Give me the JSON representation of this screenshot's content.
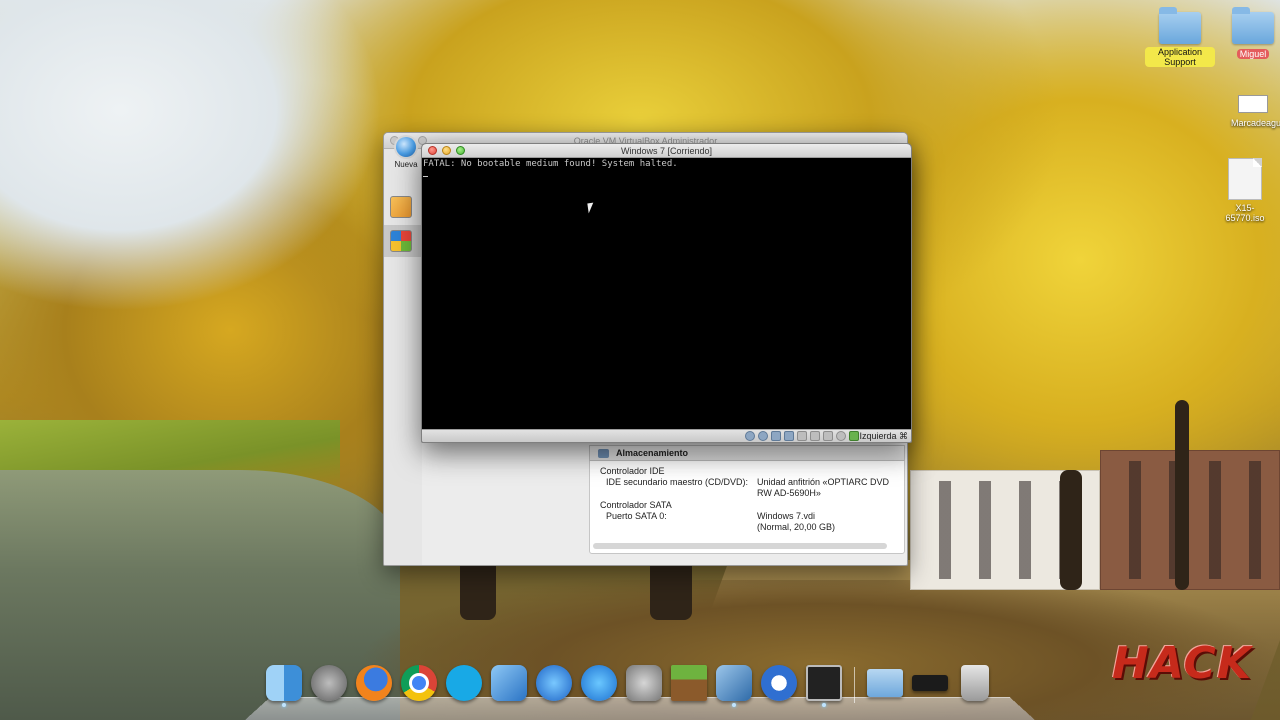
{
  "desktop": {
    "icons": [
      {
        "label": "Application Support",
        "kind": "folder"
      },
      {
        "label": "Miguel",
        "kind": "folder"
      },
      {
        "label": "Marcadeagua.png",
        "kind": "image"
      },
      {
        "label": "X15-65770.iso",
        "kind": "disk-image"
      }
    ]
  },
  "manager": {
    "title": "Oracle VM VirtualBox Administrador",
    "toolbar_new": "Nueva",
    "storage_header": "Almacenamiento",
    "storage": {
      "ide_controller": "Controlador IDE",
      "ide_port": "IDE secundario maestro (CD/DVD):",
      "ide_value_1": "Unidad anfitrión «OPTIARC DVD",
      "ide_value_2": "RW AD-5690H»",
      "sata_controller": "Controlador SATA",
      "sata_port": "Puerto SATA 0:",
      "sata_value_1": "Windows 7.vdi",
      "sata_value_2": "(Normal, 20,00 GB)"
    }
  },
  "vm_window": {
    "title": "Windows 7 [Corriendo]",
    "console_text": "FATAL: No bootable medium found! System halted.",
    "host_key": "Izquierda ⌘"
  },
  "dock": {
    "items": [
      "finder",
      "launchpad",
      "firefox",
      "chrome",
      "skype",
      "xcode",
      "itunes",
      "app-store",
      "system-preferences",
      "minecraft",
      "virtualbox",
      "quicktime",
      "screen",
      "applications-folder",
      "device",
      "trash"
    ]
  },
  "watermark": "HACK",
  "colors": {
    "console_text": "#c8c8c8",
    "console_bg": "#000000",
    "watermark": "#c62a1b",
    "label_yellow": "#f3e84a",
    "label_red": "#e45c5c"
  }
}
